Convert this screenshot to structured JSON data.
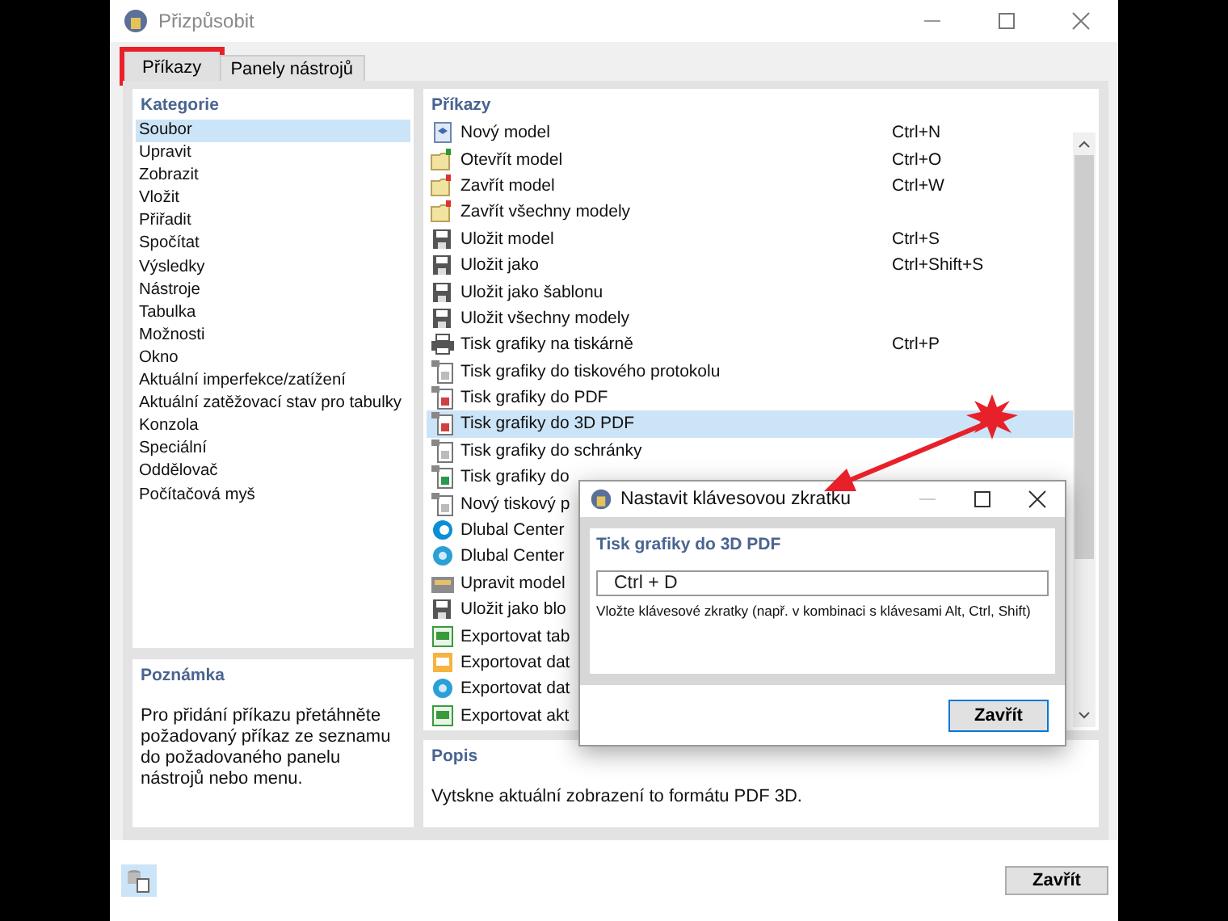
{
  "window": {
    "title": "Přizpůsobit"
  },
  "tabs": [
    {
      "label": "Příkazy",
      "selected": true,
      "highlighted": true
    },
    {
      "label": "Panely nástrojů",
      "selected": false,
      "highlighted": false
    }
  ],
  "categories": {
    "title": "Kategorie",
    "items": [
      {
        "label": "Soubor",
        "selected": true
      },
      {
        "label": "Upravit",
        "selected": false
      },
      {
        "label": "Zobrazit",
        "selected": false
      },
      {
        "label": "Vložit",
        "selected": false
      },
      {
        "label": "Přiřadit",
        "selected": false
      },
      {
        "label": "Spočítat",
        "selected": false
      },
      {
        "label": "Výsledky",
        "selected": false
      },
      {
        "label": "Nástroje",
        "selected": false
      },
      {
        "label": "Tabulka",
        "selected": false
      },
      {
        "label": "Možnosti",
        "selected": false
      },
      {
        "label": "Okno",
        "selected": false
      },
      {
        "label": "Aktuální imperfekce/zatížení",
        "selected": false
      },
      {
        "label": "Aktuální zatěžovací stav pro tabulky",
        "selected": false
      },
      {
        "label": "Konzola",
        "selected": false
      },
      {
        "label": "Speciální",
        "selected": false
      },
      {
        "label": "Oddělovač",
        "selected": false
      },
      {
        "label": "Počítačová myš",
        "selected": false
      }
    ]
  },
  "note": {
    "title": "Poznámka",
    "text": "Pro přidání příkazu přetáhněte požadovaný příkaz ze seznamu do požadovaného panelu nástrojů nebo menu."
  },
  "commands": {
    "title": "Příkazy",
    "items": [
      {
        "label": "Nový model",
        "shortcut": "Ctrl+N",
        "selected": false
      },
      {
        "label": "Otevřít model",
        "shortcut": "Ctrl+O",
        "selected": false
      },
      {
        "label": "Zavřít model",
        "shortcut": "Ctrl+W",
        "selected": false
      },
      {
        "label": "Zavřít všechny modely",
        "selected": false
      },
      {
        "label": "Uložit model",
        "shortcut": "Ctrl+S",
        "selected": false
      },
      {
        "label": "Uložit jako",
        "shortcut": "Ctrl+Shift+S",
        "selected": false
      },
      {
        "label": "Uložit jako šablonu",
        "selected": false
      },
      {
        "label": "Uložit všechny modely",
        "selected": false
      },
      {
        "label": "Tisk grafiky na tiskárně",
        "shortcut": "Ctrl+P",
        "selected": false
      },
      {
        "label": "Tisk grafiky do tiskového protokolu",
        "selected": false
      },
      {
        "label": "Tisk grafiky do PDF",
        "selected": false
      },
      {
        "label": "Tisk grafiky do 3D PDF",
        "selected": true
      },
      {
        "label": "Tisk grafiky do schránky",
        "selected": false
      },
      {
        "label": "Tisk grafiky do",
        "selected": false
      },
      {
        "label": "Nový tiskový p",
        "selected": false
      },
      {
        "label": "Dlubal Center",
        "selected": false
      },
      {
        "label": "Dlubal Center",
        "selected": false
      },
      {
        "label": "Upravit model",
        "selected": false
      },
      {
        "label": "Uložit jako blo",
        "selected": false
      },
      {
        "label": "Exportovat tab",
        "selected": false
      },
      {
        "label": "Exportovat dat",
        "selected": false
      },
      {
        "label": "Exportovat dat",
        "selected": false
      },
      {
        "label": "Exportovat akt",
        "selected": false
      }
    ]
  },
  "description": {
    "title": "Popis",
    "text": "Vytskne aktuální zobrazení to formátu PDF 3D."
  },
  "dialog": {
    "title": "Nastavit klávesovou zkratku",
    "command": "Tisk grafiky do 3D PDF",
    "shortcut_value": "Ctrl + D",
    "hint": "Vložte klávesové zkratky (např. v kombinaci s klávesami Alt, Ctrl, Shift)",
    "button": "Zavřít"
  },
  "footer_button": "Zavřít"
}
